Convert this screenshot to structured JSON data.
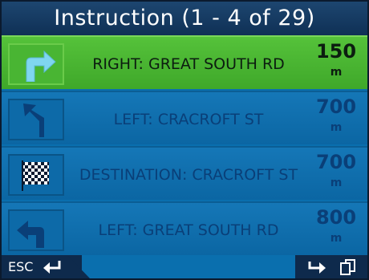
{
  "header": {
    "title": "Instruction (1 - 4 of 29)"
  },
  "rows": [
    {
      "instruction": "RIGHT: GREAT SOUTH RD",
      "distance": "150",
      "unit": "m",
      "icon": "turn-right-icon",
      "selected": true
    },
    {
      "instruction": "LEFT: CRACROFT ST",
      "distance": "700",
      "unit": "m",
      "icon": "turn-left-icon",
      "selected": false
    },
    {
      "instruction": "DESTINATION: CRACROFT ST",
      "distance": "700",
      "unit": "m",
      "icon": "checkered-flag-icon",
      "selected": false
    },
    {
      "instruction": "LEFT: GREAT SOUTH RD",
      "distance": "800",
      "unit": "m",
      "icon": "turn-left-icon",
      "selected": false
    }
  ],
  "footer": {
    "esc_label": "ESC"
  },
  "colors": {
    "selected": "#4cb834",
    "row": "#0a6fae",
    "header": "#1d4670",
    "text": "#0a3f78"
  }
}
